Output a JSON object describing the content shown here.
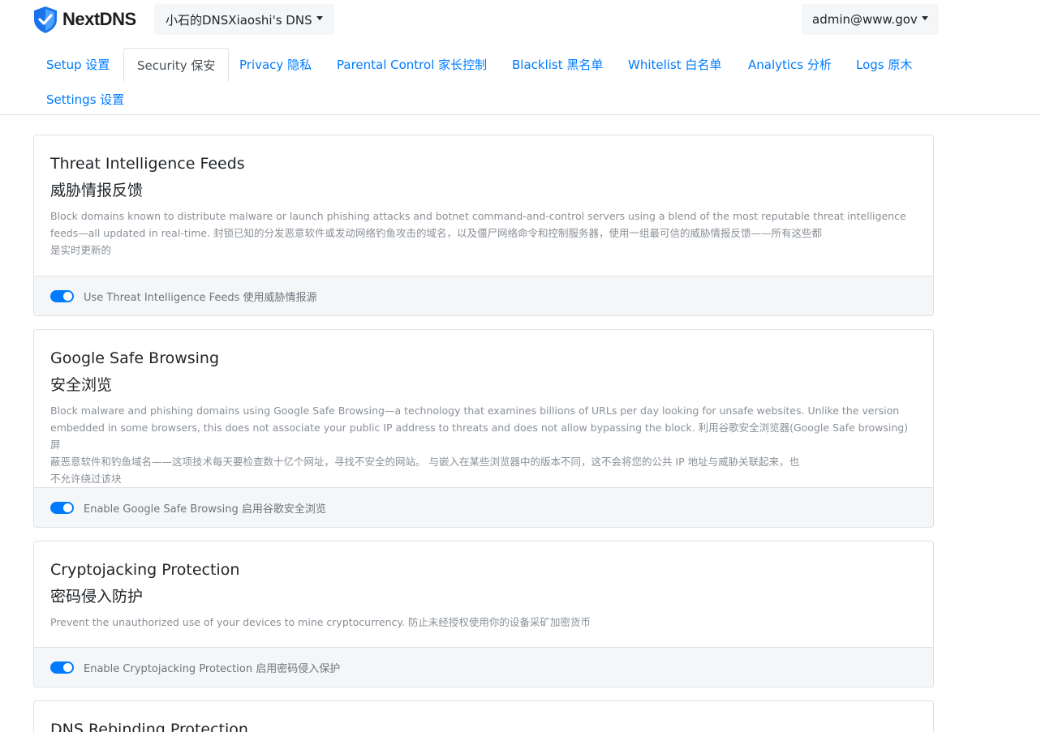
{
  "header": {
    "brand": "NextDNS",
    "profile": "小石的DNSXiaoshi's DNS",
    "account": "admin@www.gov"
  },
  "tabs": [
    {
      "label": "Setup 设置",
      "active": false
    },
    {
      "label": "Security 保安",
      "active": true
    },
    {
      "label": "Privacy 隐私",
      "active": false
    },
    {
      "label": "Parental Control 家长控制",
      "active": false
    },
    {
      "label": "Blacklist 黑名单",
      "active": false
    },
    {
      "label": "Whitelist 白名单",
      "active": false
    },
    {
      "label": "Analytics 分析",
      "active": false
    },
    {
      "label": "Logs 原木",
      "active": false
    },
    {
      "label": "Settings 设置",
      "active": false
    }
  ],
  "cards": [
    {
      "title": "Threat Intelligence Feeds",
      "title_cn": "威胁情报反馈",
      "desc_lines": [
        "Block domains known to distribute malware or launch phishing attacks and botnet command-and-control servers using a blend of the most reputable threat intelligence",
        "feeds—all updated in real-time. 封锁已知的分发恶意软件或发动网络钓鱼攻击的域名，以及僵尸网络命令和控制服务器，使用一组最可信的威胁情报反馈——所有这些都",
        "是实时更新的"
      ],
      "toggle_label": "Use Threat Intelligence Feeds 使用威胁情报源",
      "enabled": true
    },
    {
      "title": "Google Safe Browsing",
      "title_cn": "安全浏览",
      "desc_lines": [
        "Block malware and phishing domains using Google Safe Browsing—a technology that examines billions of URLs per day looking for unsafe websites. Unlike the version",
        "embedded in some browsers, this does not associate your public IP address to threats and does not allow bypassing the block. 利用谷歌安全浏览器(Google Safe browsing)屏",
        "蔽恶意软件和钓鱼域名——这项技术每天要检查数十亿个网址，寻找不安全的网站。 与嵌入在某些浏览器中的版本不同，这不会将您的公共 IP 地址与威胁关联起来，也",
        "不允许绕过该块"
      ],
      "toggle_label": "Enable Google Safe Browsing 启用谷歌安全浏览",
      "enabled": true
    },
    {
      "title": "Cryptojacking Protection",
      "title_cn": "密码侵入防护",
      "desc_lines": [
        "Prevent the unauthorized use of your devices to mine cryptocurrency. 防止未经授权使用你的设备采矿加密货币"
      ],
      "toggle_label": "Enable Cryptojacking Protection 启用密码侵入保护",
      "enabled": true
    },
    {
      "title": "DNS Rebinding Protection"
    }
  ],
  "colors": {
    "accent": "#007bff",
    "brand_shield": "#1a73e8"
  }
}
